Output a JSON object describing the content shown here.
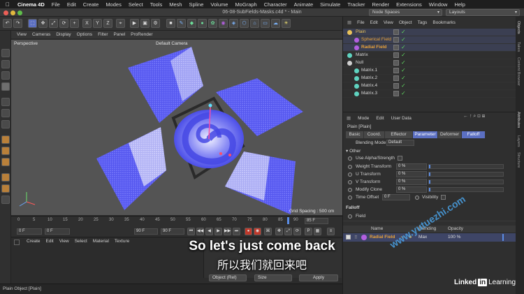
{
  "menubar": {
    "apple": "",
    "app": "Cinema 4D",
    "items": [
      "File",
      "Edit",
      "Create",
      "Modes",
      "Select",
      "Tools",
      "Mesh",
      "Spline",
      "Volume",
      "MoGraph",
      "Character",
      "Animate",
      "Simulate",
      "Tracker",
      "Render",
      "Extensions",
      "Window",
      "Help"
    ]
  },
  "window": {
    "title": "06-08-SubFields-Masks.c4d * - Main",
    "node_spaces": "Node Spaces",
    "layouts": "Layouts"
  },
  "toolbar": {
    "axis_x": "X",
    "axis_y": "Y",
    "axis_z": "Z"
  },
  "viewport_menu": [
    "View",
    "Cameras",
    "Display",
    "Options",
    "Filter",
    "Panel",
    "ProRender"
  ],
  "viewport": {
    "label": "Perspective",
    "camera": "Default Camera ",
    "grid_spacing": "Grid Spacing : 500 cm"
  },
  "timeline": {
    "ticks": [
      "0",
      "5",
      "10",
      "15",
      "20",
      "25",
      "30",
      "35",
      "40",
      "45",
      "50",
      "55",
      "60",
      "65",
      "70",
      "75",
      "80",
      "85",
      "90"
    ],
    "current_frame": "85 F",
    "start": "0 F",
    "start2": "0 F",
    "end": "90 F",
    "end2": "90 F"
  },
  "material_menu": [
    "Create",
    "Edit",
    "View",
    "Select",
    "Material",
    "Texture"
  ],
  "material_bottom": {
    "coord_mode": "Object (Rel)",
    "size_mode": "Size",
    "apply": "Apply"
  },
  "status": "Plain Object [Plain]",
  "object_manager": {
    "menu": [
      "File",
      "Edit",
      "View",
      "Object",
      "Tags",
      "Bookmarks"
    ],
    "objects": [
      {
        "name": "Plain",
        "color": "#e8c25a",
        "indent": 0
      },
      {
        "name": "Spherical Field",
        "color": "#b35fe0",
        "indent": 1
      },
      {
        "name": "Radial Field",
        "color": "#b35fe0",
        "indent": 1
      },
      {
        "name": "Matrix",
        "color": "#5fd3c0",
        "indent": 0
      },
      {
        "name": "Null",
        "color": "#cfcfcf",
        "indent": 0
      },
      {
        "name": "Matrix.1",
        "color": "#5fd3c0",
        "indent": 1
      },
      {
        "name": "Matrix.2",
        "color": "#5fd3c0",
        "indent": 1
      },
      {
        "name": "Matrix.4",
        "color": "#5fd3c0",
        "indent": 1
      },
      {
        "name": "Matrix.3",
        "color": "#5fd3c0",
        "indent": 1
      }
    ]
  },
  "attributes": {
    "menu": [
      "Mode",
      "Edit",
      "User Data"
    ],
    "object_title": "Plain [Plain]",
    "tabs": [
      "Basic",
      "Coord.",
      "Effector",
      "Parameter",
      "Deformer",
      "Falloff"
    ],
    "active_tabs": [
      "Parameter",
      "Falloff"
    ],
    "blending_mode_label": "Blending Mode",
    "blending_mode_value": "Default",
    "other_section": "Other",
    "use_alpha": "Use Alpha/Strength",
    "params": [
      {
        "label": "Weight Transform",
        "value": "0 %"
      },
      {
        "label": "U Transform",
        "value": "0 %"
      },
      {
        "label": "V Transform",
        "value": "0 %"
      },
      {
        "label": "Modify Clone",
        "value": "0 %"
      }
    ],
    "time_offset_label": "Time Offset",
    "time_offset_value": "0 F",
    "visibility": "Visibility",
    "falloff_section": "Falloff",
    "field_label": "Field",
    "field_columns": {
      "name": "Name",
      "blending": "Blending",
      "opacity": "Opacity"
    },
    "field_row": {
      "name": "Radial Field",
      "blending": "Max",
      "opacity": "100 %"
    }
  },
  "right_tabs": [
    "Objects",
    "Takes",
    "Content Browser",
    "Attributes",
    "Layers",
    "Structure"
  ],
  "subtitles": {
    "english": "So let's just come back",
    "chinese": "所以我们就回来吧"
  },
  "watermark": "www.yutuezhi.com",
  "branding": {
    "linked": "Linked",
    "in": "in",
    "learning": "Learning"
  },
  "colors": {
    "accent": "#5b6fc2",
    "field_blue": "#5c5ef0",
    "check_green": "#5fd35f",
    "radial_orange": "#e8a23a"
  }
}
